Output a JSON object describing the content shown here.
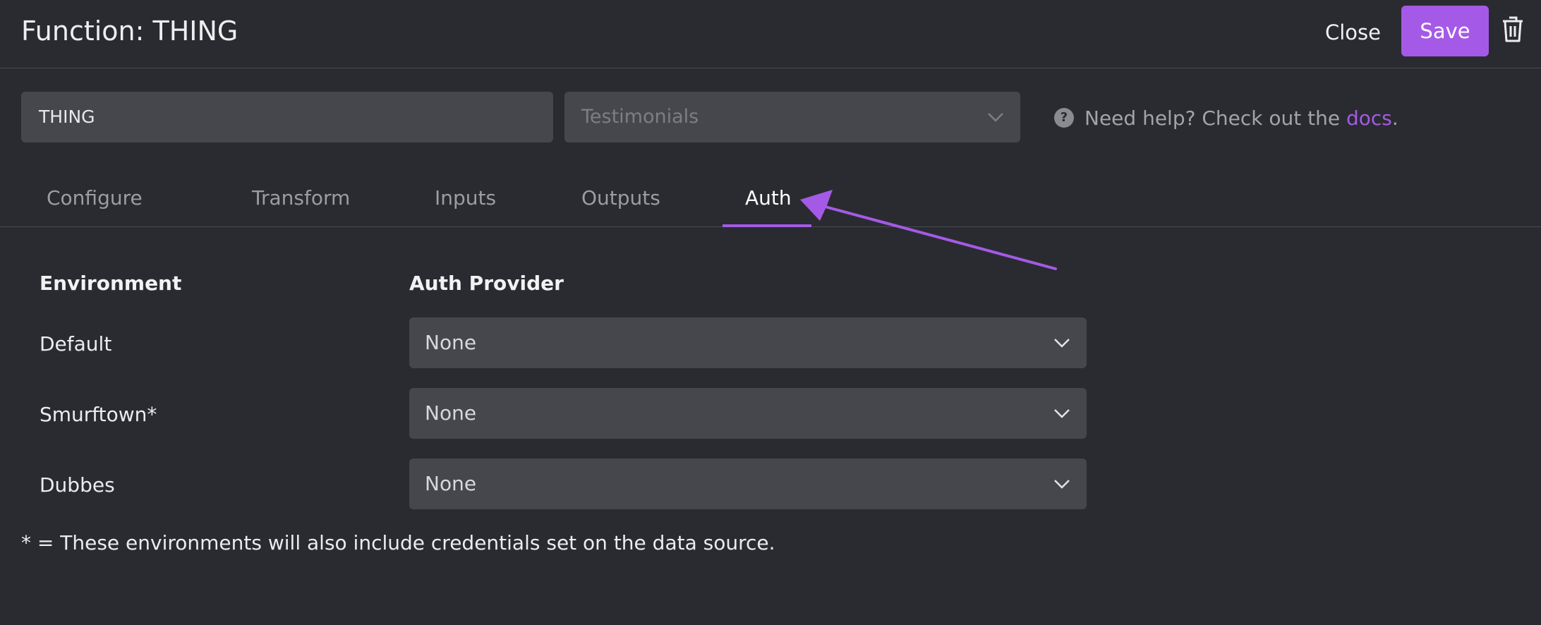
{
  "header": {
    "title": "Function: THING",
    "close_label": "Close",
    "save_label": "Save",
    "delete_icon": "trash-icon"
  },
  "form": {
    "name_value": "THING",
    "source_placeholder": "Testimonials"
  },
  "help": {
    "icon": "question-icon",
    "text_before": "Need help? Check out the ",
    "link_text": "docs",
    "text_after": "."
  },
  "tabs": [
    {
      "label": "Configure",
      "active": false
    },
    {
      "label": "Transform",
      "active": false
    },
    {
      "label": "Inputs",
      "active": false
    },
    {
      "label": "Outputs",
      "active": false
    },
    {
      "label": "Auth",
      "active": true
    }
  ],
  "auth": {
    "environment_header": "Environment",
    "provider_header": "Auth Provider",
    "rows": [
      {
        "environment": "Default",
        "provider": "None"
      },
      {
        "environment": "Smurftown*",
        "provider": "None"
      },
      {
        "environment": "Dubbes",
        "provider": "None"
      }
    ],
    "footnote": "* = These environments will also include credentials set on the data source."
  },
  "colors": {
    "background": "#2a2b30",
    "accent": "#a45ae6",
    "field": "#46474c"
  }
}
